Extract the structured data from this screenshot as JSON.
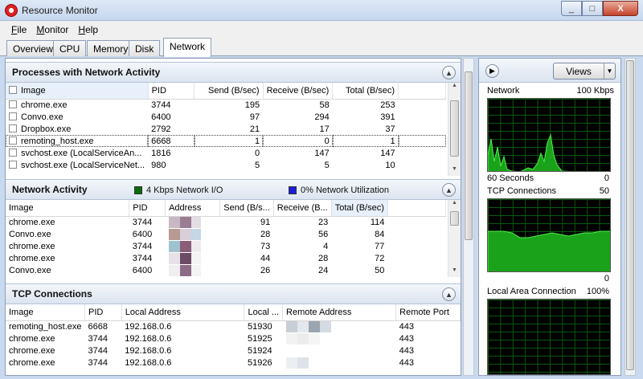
{
  "window": {
    "title": "Resource Monitor",
    "controls": [
      "_",
      "□",
      "X"
    ]
  },
  "menu": [
    {
      "label": "File",
      "u": "F",
      "rest": "ile"
    },
    {
      "label": "Monitor",
      "u": "M",
      "rest": "onitor"
    },
    {
      "label": "Help",
      "u": "H",
      "rest": "elp"
    }
  ],
  "tabs": [
    "Overview",
    "CPU",
    "Memory",
    "Disk",
    "Network"
  ],
  "active_tab": "Network",
  "processes": {
    "title": "Processes with Network Activity",
    "columns": [
      "Image",
      "PID",
      "Send (B/sec)",
      "Receive (B/sec)",
      "Total (B/sec)"
    ],
    "rows": [
      [
        "chrome.exe",
        "3744",
        "195",
        "58",
        "253"
      ],
      [
        "Convo.exe",
        "6400",
        "97",
        "294",
        "391"
      ],
      [
        "Dropbox.exe",
        "2792",
        "21",
        "17",
        "37"
      ],
      [
        "remoting_host.exe",
        "6668",
        "1",
        "0",
        "1"
      ],
      [
        "svchost.exe (LocalServiceAn...",
        "1816",
        "0",
        "147",
        "147"
      ],
      [
        "svchost.exe (LocalServiceNet...",
        "980",
        "5",
        "5",
        "10"
      ]
    ]
  },
  "network_activity": {
    "title": "Network Activity",
    "legend1": "4 Kbps Network I/O",
    "legend1_color": "#0a6d0a",
    "legend2": "0% Network Utilization",
    "legend2_color": "#1c1cd8",
    "columns": [
      "Image",
      "PID",
      "Address",
      "Send (B/s...",
      "Receive (B...",
      "Total (B/sec)"
    ],
    "rows": [
      [
        "chrome.exe",
        "3744",
        "91",
        "23",
        "114"
      ],
      [
        "Convo.exe",
        "6400",
        "28",
        "56",
        "84"
      ],
      [
        "chrome.exe",
        "3744",
        "73",
        "4",
        "77"
      ],
      [
        "chrome.exe",
        "3744",
        "44",
        "28",
        "72"
      ],
      [
        "Convo.exe",
        "6400",
        "26",
        "24",
        "50"
      ]
    ]
  },
  "tcp": {
    "title": "TCP Connections",
    "columns": [
      "Image",
      "PID",
      "Local Address",
      "Local ...",
      "Remote Address",
      "Remote Port"
    ],
    "rows": [
      [
        "remoting_host.exe",
        "6668",
        "192.168.0.6",
        "51930",
        "443"
      ],
      [
        "chrome.exe",
        "3744",
        "192.168.0.6",
        "51925",
        "443"
      ],
      [
        "chrome.exe",
        "3744",
        "192.168.0.6",
        "51924",
        "443"
      ],
      [
        "chrome.exe",
        "3744",
        "192.168.0.6",
        "51926",
        "443"
      ]
    ]
  },
  "graphs": {
    "views_label": "Views",
    "network": {
      "label": "Network",
      "max": "100 Kbps",
      "time": "60 Seconds",
      "min": "0"
    },
    "tcp": {
      "label": "TCP Connections",
      "max": "50",
      "min": "0"
    },
    "lan": {
      "label": "Local Area Connection",
      "max": "100%"
    }
  }
}
